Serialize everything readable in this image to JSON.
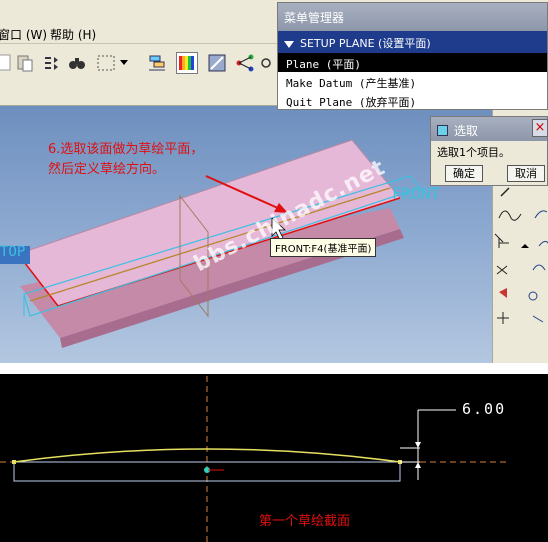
{
  "menubar": {
    "items": [
      "窗口 (W)",
      "帮助 (H)"
    ]
  },
  "menu_manager": {
    "title": "菜单管理器",
    "section": "SETUP PLANE (设置平面)",
    "items": [
      {
        "label": "Plane (平面)",
        "selected": true
      },
      {
        "label": "Make Datum (产生基准)",
        "selected": false
      },
      {
        "label": "Quit Plane (放弃平面)",
        "selected": false
      }
    ]
  },
  "select_dialog": {
    "title": "选取",
    "message": "选取1个项目。",
    "ok_label": "确定",
    "cancel_label": "取消",
    "close_icon": "×"
  },
  "viewport": {
    "annotation_line1": "6.选取该面做为草绘平面，",
    "annotation_line2": "然后定义草绘方向。",
    "front_label": "FRONT",
    "top_label": "TOP",
    "tooltip": "FRONT:F4(基准平面)",
    "watermark": "bbs.chinadc.net"
  },
  "sketch": {
    "dimension": "6.00",
    "caption": "第一个草绘截面"
  },
  "colors": {
    "menu_setup_bg": "#1e3b8c",
    "annotation_red": "#e01010",
    "datum_cyan": "#3cc0e0",
    "part_pink": "#e6b8d8"
  }
}
